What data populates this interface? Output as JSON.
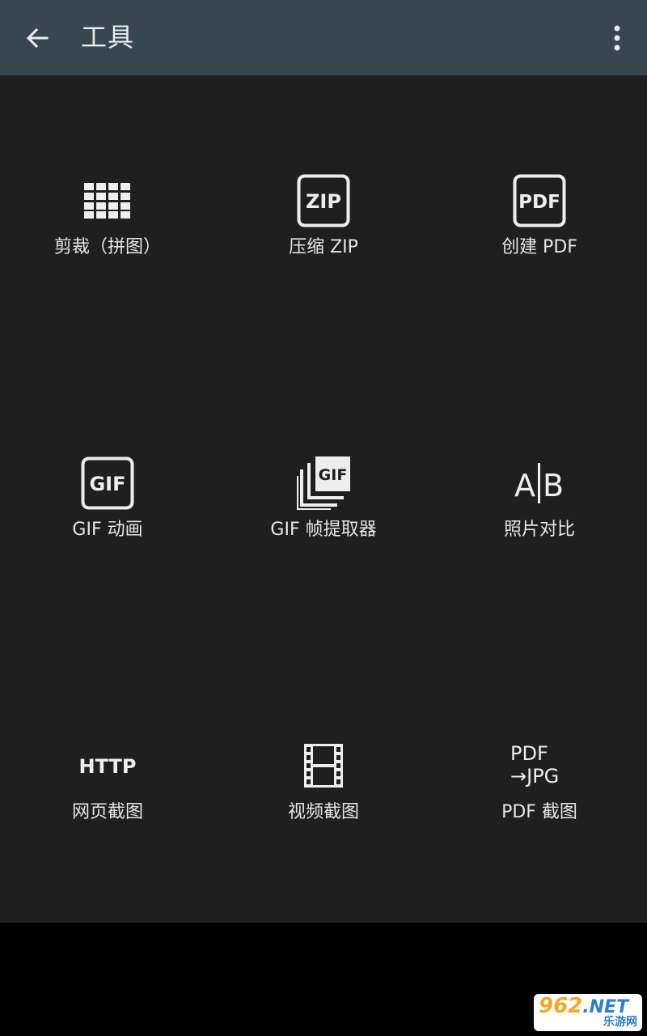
{
  "toolbar": {
    "back_icon": "arrow-left-icon",
    "title": "工具",
    "menu_icon": "more-vertical-icon"
  },
  "tools": [
    {
      "label": "剪裁（拼图）",
      "icon": "grid-crop-icon"
    },
    {
      "label": "压缩 ZIP",
      "icon": "zip-icon",
      "badge": "ZIP"
    },
    {
      "label": "创建 PDF",
      "icon": "pdf-icon",
      "badge": "PDF"
    },
    {
      "label": "GIF 动画",
      "icon": "gif-icon",
      "badge": "GIF"
    },
    {
      "label": "GIF 帧提取器",
      "icon": "gif-frames-icon",
      "badge": "GIF"
    },
    {
      "label": "照片对比",
      "icon": "ab-compare-icon",
      "badge_a": "A",
      "badge_b": "B"
    },
    {
      "label": "网页截图",
      "icon": "http-icon",
      "badge": "HTTP"
    },
    {
      "label": "视频截图",
      "icon": "film-strip-icon"
    },
    {
      "label": "PDF 截图",
      "icon": "pdf-to-jpg-icon",
      "badge_top": "PDF",
      "badge_bottom": "→JPG"
    }
  ],
  "colors": {
    "toolbar_bg": "#37474f",
    "content_bg": "#1f1f1f",
    "text": "#e6e6e6"
  },
  "watermark": {
    "main": "962",
    "net": ".NET",
    "sub": "乐游网"
  }
}
